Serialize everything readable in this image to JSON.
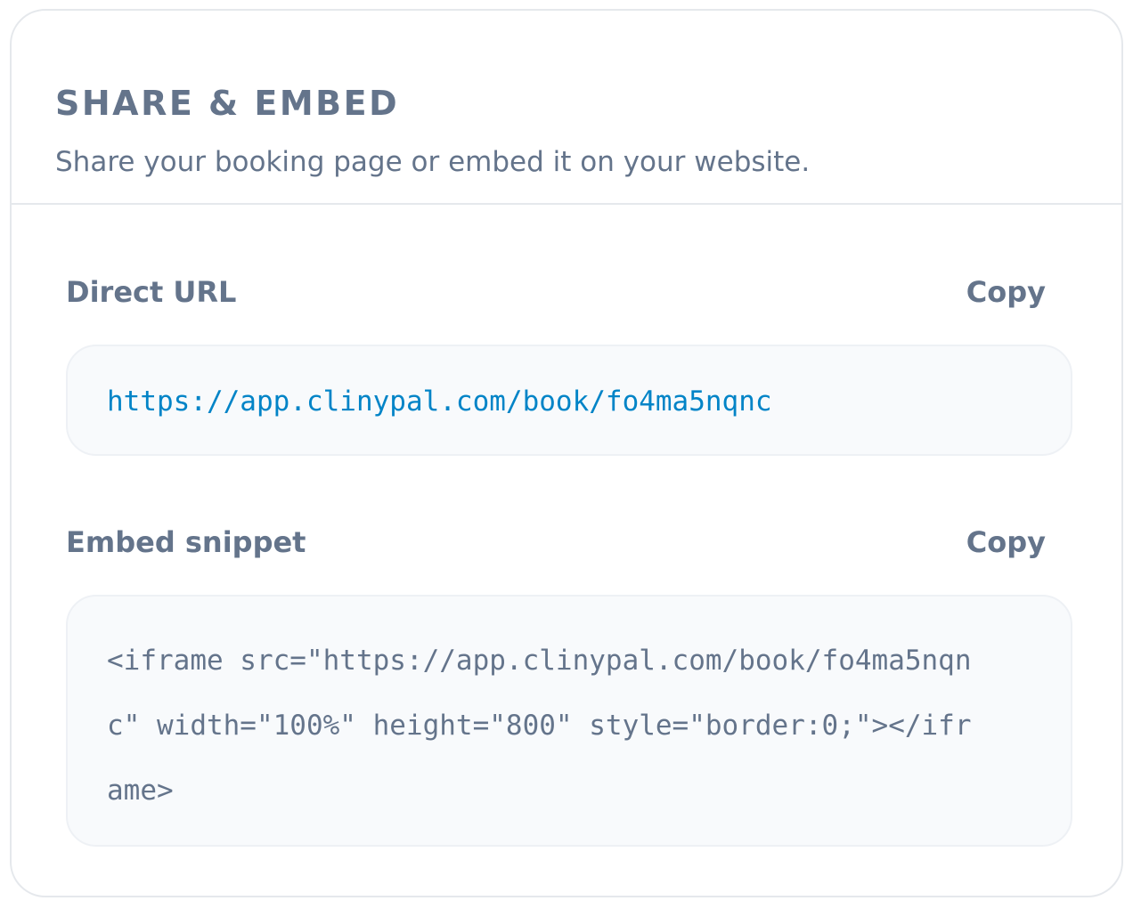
{
  "card": {
    "title": "SHARE & EMBED",
    "subtitle": "Share your booking page or embed it on your website."
  },
  "direct_url": {
    "label": "Direct URL",
    "copy_label": "Copy",
    "value": "https://app.clinypal.com/book/fo4ma5nqnc"
  },
  "embed_snippet": {
    "label": "Embed snippet",
    "copy_label": "Copy",
    "lines": [
      "<iframe src=\"https://app.clinypal.com/book/fo4ma5nqn",
      "c\" width=\"100%\" height=\"800\" style=\"border:0;\"></ifr",
      "ame>"
    ]
  },
  "colors": {
    "text_muted": "#64748b",
    "link": "#0284c7",
    "code_bg": "#f8fafc",
    "border": "#e5e8ec"
  }
}
